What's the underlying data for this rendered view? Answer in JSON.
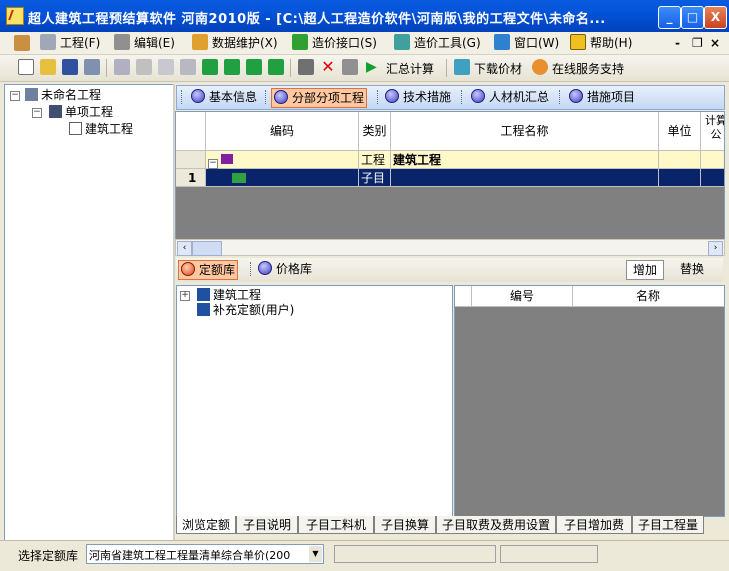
{
  "window": {
    "title": "超人建筑工程预结算软件 河南2010版 - [C:\\超人工程造价软件\\河南版\\我的工程文件\\未命名...",
    "minimize": "_",
    "maximize": "□",
    "close": "X"
  },
  "menu": {
    "items": [
      {
        "label": "工程(F)",
        "icon": "gears-icon"
      },
      {
        "label": "编辑(E)",
        "icon": "pencil-icon"
      },
      {
        "label": "数据维护(X)",
        "icon": "paint-icon"
      },
      {
        "label": "造价接口(S)",
        "icon": "arrow-down-icon"
      },
      {
        "label": "造价工具(G)",
        "icon": "tools-icon"
      },
      {
        "label": "窗口(W)",
        "icon": "window-icon"
      },
      {
        "label": "帮助(H)",
        "icon": "help-icon"
      }
    ],
    "mdi_min": "-",
    "mdi_restore": "❐",
    "mdi_close": "×"
  },
  "toolbar": {
    "calc_label": "汇总计算",
    "download_label": "下载价材",
    "support_label": "在线服务支持"
  },
  "tree": {
    "root": "未命名工程",
    "child": "单项工程",
    "leaf": "建筑工程"
  },
  "tabs": {
    "items": [
      "基本信息",
      "分部分项工程",
      "技术措施",
      "人材机汇总",
      "措施项目"
    ],
    "active_index": 1
  },
  "grid": {
    "headers": [
      "编码",
      "类别",
      "工程名称",
      "单位",
      "计算公"
    ],
    "rows": [
      {
        "num": "",
        "code": "",
        "type": "工程",
        "name": "建筑工程",
        "unit": ""
      },
      {
        "num": "1",
        "code": "",
        "type": "子目",
        "name": "",
        "unit": ""
      }
    ]
  },
  "library": {
    "tab_quota": "定额库",
    "tab_price": "价格库",
    "add_label": "增加",
    "replace_label": "替换",
    "tree_items": [
      "建筑工程",
      "补充定额(用户)"
    ],
    "right_headers": [
      "编号",
      "名称"
    ]
  },
  "bottom_tabs": [
    "浏览定额",
    "子目说明",
    "子目工料机",
    "子目换算",
    "子目取费及费用设置",
    "子目增加费",
    "子目工程量"
  ],
  "status": {
    "label": "选择定额库",
    "dropdown_value": "河南省建筑工程工程量清单综合单价(200"
  },
  "colors": {
    "titlebar": "#0453D8",
    "active_tab": "#FFC8A0",
    "selected_row": "#0A246A",
    "header_row": "#FFF8C8"
  }
}
